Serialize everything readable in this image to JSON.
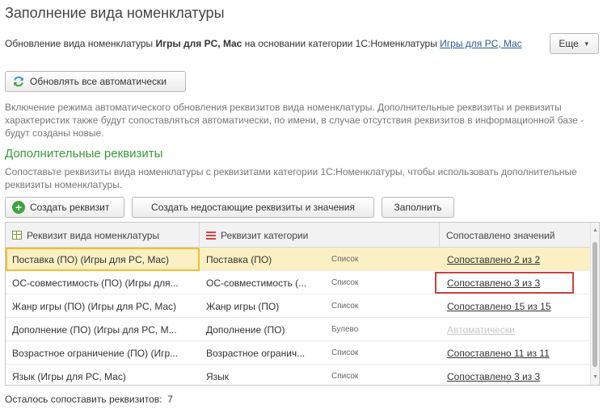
{
  "window": {
    "title": "Заполнение вида номенклатуры"
  },
  "header": {
    "prefix": "Обновление вида номенклатуры ",
    "kind_name": "Игры для PC, Mac",
    "middle": " на основании категории 1С:Номенклатуры ",
    "category_link": "Игры для PC, Mac",
    "more_label": "Еще"
  },
  "auto_button": {
    "label": "Обновлять все автоматически",
    "icon": "refresh-icon"
  },
  "description": "Включение режима автоматического обновления реквизитов вида номенклатуры. Дополнительные реквизиты и реквизиты характеристик также будут сопоставляться автоматически, по имени, в случае отсутствия реквизитов в информационной базе - будут созданы новые.",
  "section": {
    "title": "Дополнительные реквизиты",
    "description": "Сопоставьте реквизиты вида номенклатуры с реквизитами категории 1С:Номенклатуры, чтобы использовать дополнительные реквизиты номенклатуры."
  },
  "toolbar": {
    "create_label": "Создать реквизит",
    "create_missing_label": "Создать недостающие реквизиты и значения",
    "fill_label": "Заполнить"
  },
  "table": {
    "columns": [
      "Реквизит вида номенклатуры",
      "Реквизит категории",
      "Сопоставлено значений"
    ],
    "rows": [
      {
        "attr": "Поставка (ПО) (Игры для PC, Mac)",
        "category": "Поставка (ПО)",
        "type": "Список",
        "matched": "Сопоставлено 2 из 2"
      },
      {
        "attr": "ОС-совместимость (ПО) (Игры для...",
        "category": "ОС-совместимость (...",
        "type": "Список",
        "matched": "Сопоставлено 3 из 3"
      },
      {
        "attr": "Жанр игры (ПО) (Игры для PC, Mac)",
        "category": "Жанр игры (ПО)",
        "type": "Список",
        "matched": "Сопоставлено 15 из 15"
      },
      {
        "attr": "Дополнение (ПО) (Игры для PC, M...",
        "category": "Дополнение (ПО)",
        "type": "Булево",
        "matched": "Автоматически"
      },
      {
        "attr": "Возрастное ограничение (ПО) (Игр...",
        "category": "Возрастное огранич...",
        "type": "Список",
        "matched": "Сопоставлено 11 из 11"
      },
      {
        "attr": "Язык (Игры для PC, Mac)",
        "category": "Язык",
        "type": "Список",
        "matched": "Сопоставлено 3 из 3"
      }
    ]
  },
  "footer": {
    "label": "Осталось сопоставить реквизитов:",
    "count": "7"
  },
  "colors": {
    "accent_green": "#3a9a3a",
    "selection": "#fbf0c4",
    "highlight_red": "#d04040",
    "link": "#2a5a9a"
  }
}
